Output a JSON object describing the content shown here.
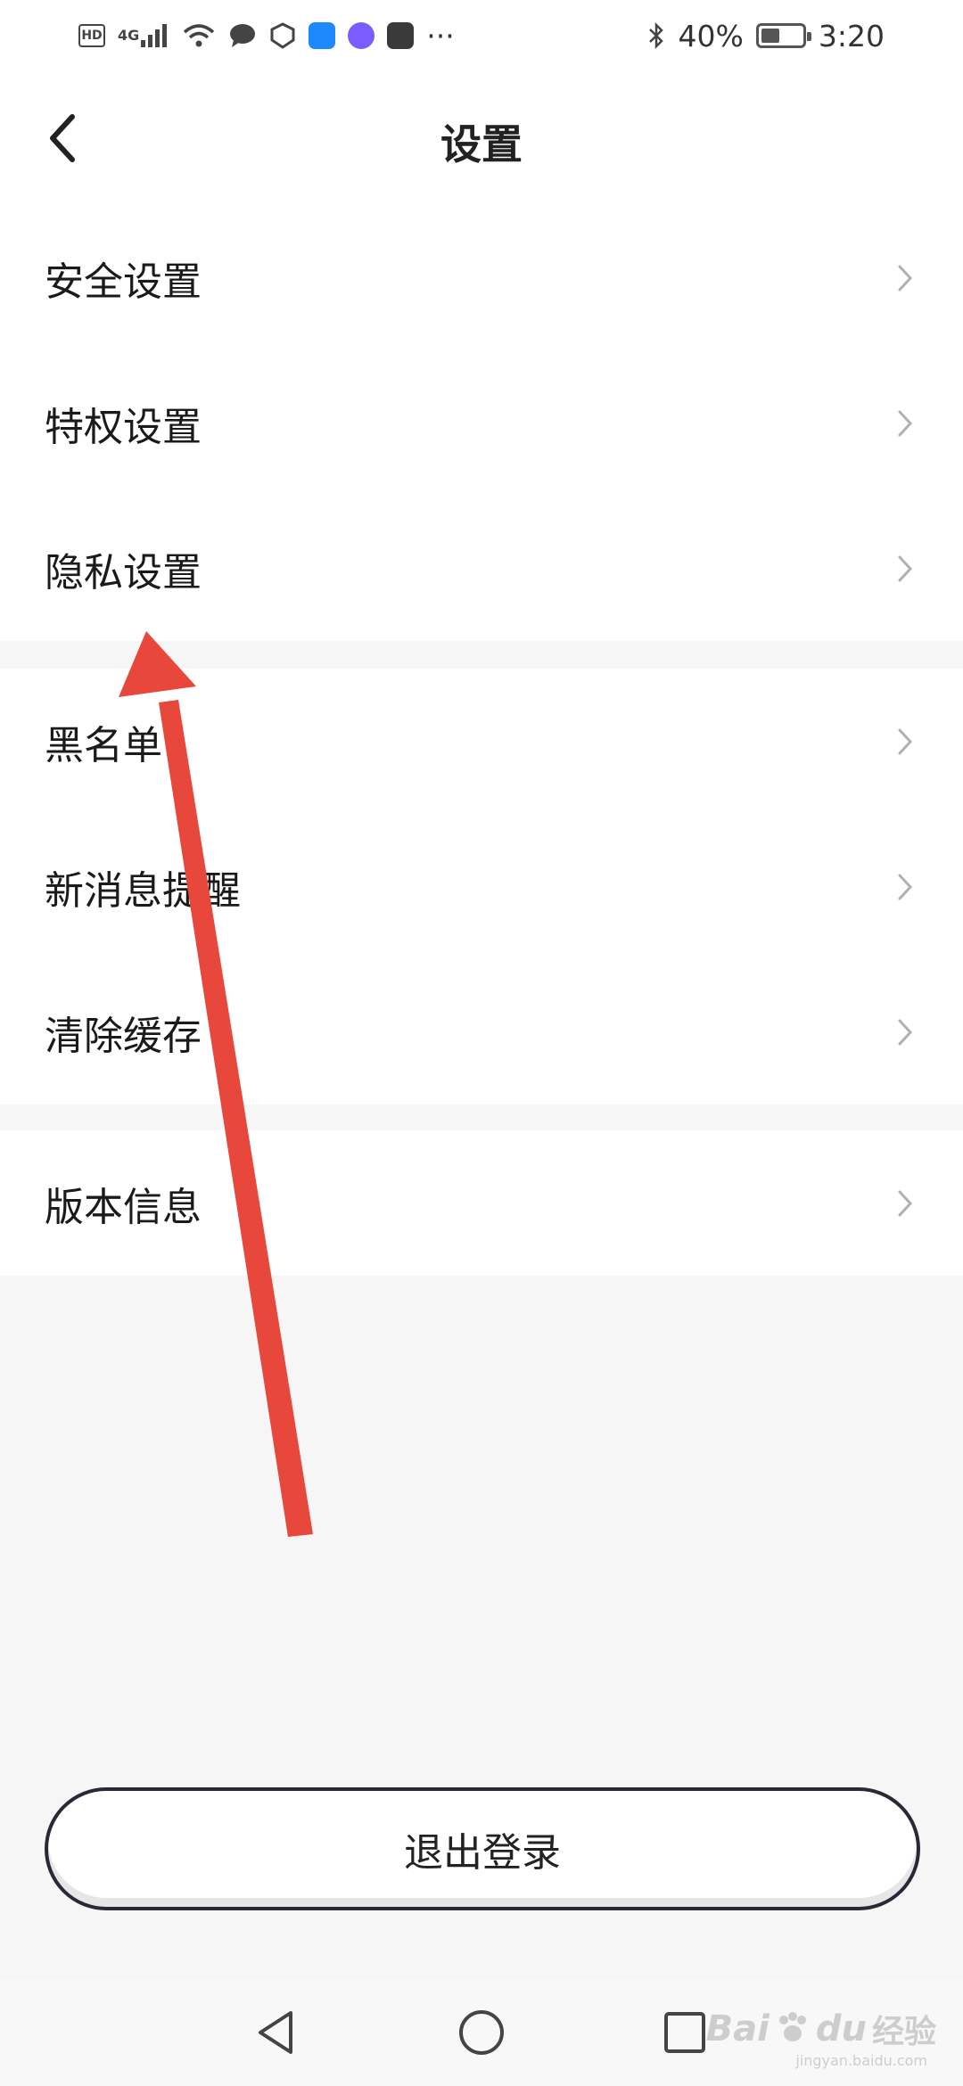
{
  "status_bar": {
    "hd": "HD",
    "network": "4G",
    "more": "···",
    "battery_percent": "40%",
    "battery_level": 0.4,
    "time": "3:20"
  },
  "header": {
    "title": "设置",
    "back_icon": "chevron-left-icon"
  },
  "groups": [
    {
      "items": [
        {
          "label": "安全设置"
        },
        {
          "label": "特权设置"
        },
        {
          "label": "隐私设置"
        }
      ]
    },
    {
      "items": [
        {
          "label": "黑名单"
        },
        {
          "label": "新消息提醒"
        },
        {
          "label": "清除缓存"
        }
      ]
    },
    {
      "items": [
        {
          "label": "版本信息"
        }
      ]
    }
  ],
  "logout": {
    "label": "退出登录"
  },
  "nav_bar": {
    "icons": [
      "nav-back-icon",
      "nav-home-icon",
      "nav-recent-icon"
    ]
  },
  "watermark": {
    "brand": "Bai",
    "paw": "du",
    "cn": "经验",
    "domain": "jingyan.baidu.com"
  },
  "colors": {
    "background": "#f6f6f6",
    "surface": "#ffffff",
    "text": "#1a1a1a",
    "chevron": "#b0b0b0",
    "annotation": "#e8483b",
    "logout_border": "#2a2838"
  }
}
